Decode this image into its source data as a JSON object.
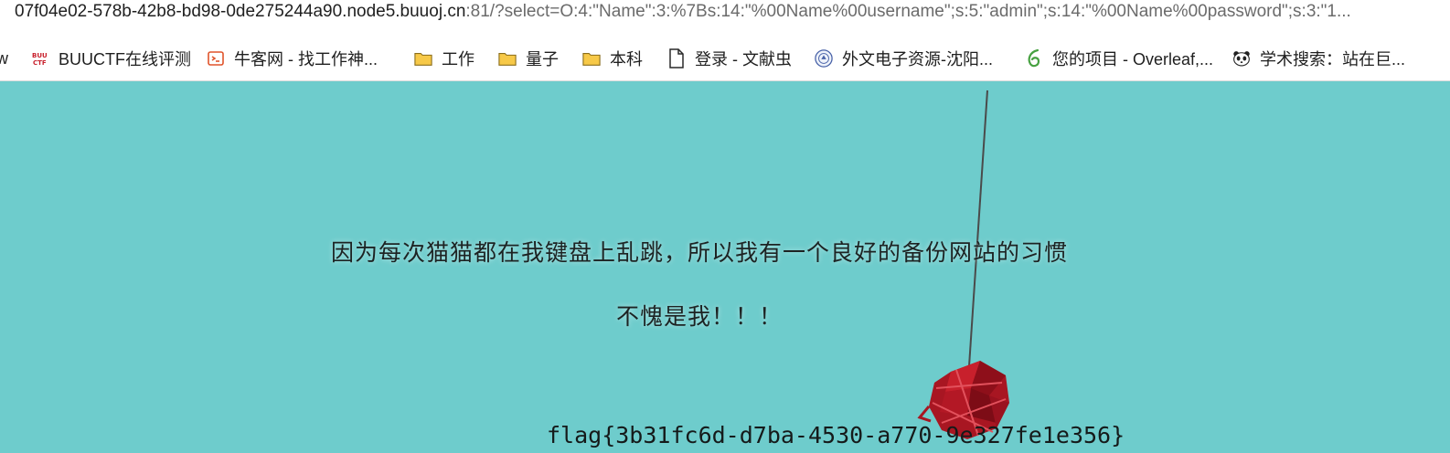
{
  "browser": {
    "url_host": "07f04e02-578b-42b8-bd98-0de275244a90.node5.buuoj.cn",
    "url_rest": ":81/?select=O:4:\"Name\":3:%7Bs:14:\"%00Name%00username\";s:5:\"admin\";s:14:\"%00Name%00password\";s:3:\"1..."
  },
  "bookmarks": [
    {
      "label": "w",
      "icon": "none"
    },
    {
      "label": "BUUCTF在线评测",
      "icon": "buuctf-logo-icon"
    },
    {
      "label": "牛客网 - 找工作神...",
      "icon": "nowcoder-logo-icon"
    },
    {
      "label": "工作",
      "icon": "folder-icon"
    },
    {
      "label": "量子",
      "icon": "folder-icon"
    },
    {
      "label": "本科",
      "icon": "folder-icon"
    },
    {
      "label": "登录 - 文献虫",
      "icon": "document-icon"
    },
    {
      "label": "外文电子资源-沈阳...",
      "icon": "university-seal-icon"
    },
    {
      "label": "您的项目 - Overleaf,...",
      "icon": "overleaf-leaf-icon"
    },
    {
      "label": "学术搜索：站在巨...",
      "icon": "panda-icon"
    }
  ],
  "page": {
    "line1": "因为每次猫猫都在我键盘上乱跳，所以我有一个良好的备份网站的习惯",
    "line2": "不愧是我！！！",
    "flag": "flag{3b31fc6d-d7ba-4530-a770-9e327fe1e356}"
  },
  "colors": {
    "background": "#6ecccc",
    "yarn": "#a81622",
    "folder": "#f7c948",
    "overleaf": "#47a141"
  }
}
